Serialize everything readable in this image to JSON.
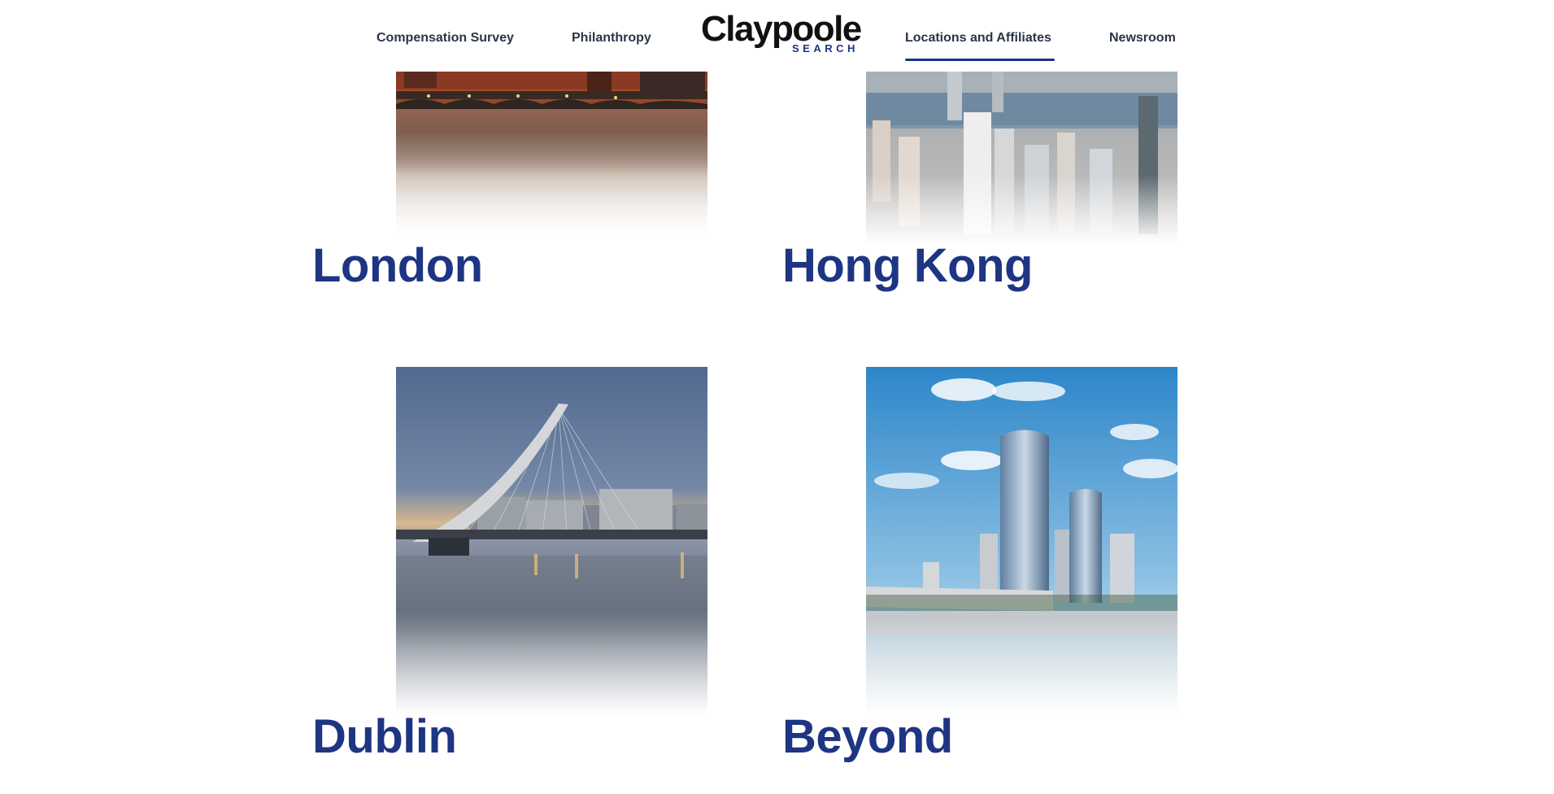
{
  "nav": {
    "compensation_survey": "Compensation Survey",
    "philanthropy": "Philanthropy",
    "locations": "Locations and Affiliates",
    "newsroom": "Newsroom"
  },
  "logo": {
    "word": "Claypoole",
    "sub": "SEARCH"
  },
  "locations": [
    {
      "name": "London"
    },
    {
      "name": "Hong Kong"
    },
    {
      "name": "Dublin"
    },
    {
      "name": "Beyond"
    }
  ],
  "colors": {
    "accent": "#1d3583",
    "nav_text": "#2b3447"
  }
}
